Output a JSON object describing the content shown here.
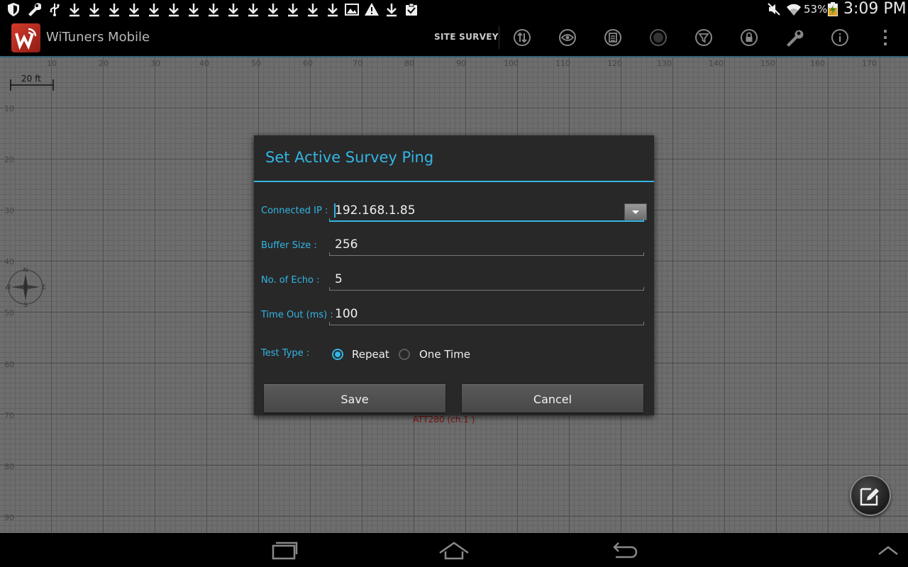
{
  "status_bar": {
    "left_icons": [
      "shield-icon",
      "wrench-icon",
      "usb-icon",
      "download-icon",
      "download-icon",
      "download-icon",
      "download-icon",
      "download-icon",
      "download-icon",
      "download-icon",
      "download-icon",
      "download-icon",
      "download-icon",
      "download-icon",
      "download-icon",
      "download-icon",
      "download-icon",
      "image-icon",
      "warning-icon",
      "download-icon",
      "clipboard-check-icon"
    ],
    "right_icons": [
      "mute-icon",
      "wifi-icon",
      "battery-charging-icon"
    ],
    "battery": "53%",
    "time": "3:09 PM"
  },
  "action_bar": {
    "app_title": "WiTuners Mobile",
    "mode_label": "SITE SURVEY",
    "buttons": [
      "transfer-icon",
      "eye-icon",
      "list-icon",
      "record-icon",
      "filter-icon",
      "lock-icon",
      "wrench-icon",
      "info-icon",
      "overflow-menu-icon"
    ]
  },
  "canvas": {
    "x_ticks": [
      "10",
      "20",
      "30",
      "40",
      "50",
      "60",
      "70",
      "80",
      "90",
      "100",
      "110",
      "120",
      "130",
      "140",
      "150",
      "160",
      "170"
    ],
    "y_ticks": [
      "10",
      "20",
      "30",
      "40",
      "50",
      "60",
      "70",
      "80",
      "90"
    ],
    "scale_label": "20 ft",
    "access_point_label": "ATT280 (ch.1 )",
    "compass_letters": {
      "n": "N",
      "e": "E",
      "s": "S",
      "w": "W"
    }
  },
  "dialog": {
    "title": "Set Active Survey Ping",
    "connected_ip_label": "Connected IP :",
    "connected_ip_value": "192.168.1.85",
    "buffer_size_label": "Buffer Size :",
    "buffer_size_value": "256",
    "echo_label": "No. of Echo :",
    "echo_value": "5",
    "timeout_label": "Time Out (ms) :",
    "timeout_value": "100",
    "test_type_label": "Test Type :",
    "test_type_options": [
      "Repeat",
      "One Time"
    ],
    "test_type_selected": "Repeat",
    "save_label": "Save",
    "cancel_label": "Cancel"
  },
  "colors": {
    "accent": "#33b5e5",
    "dialog_bg": "#282828",
    "canvas_bg": "#6e6e6e",
    "ap_label": "#7a1010"
  }
}
